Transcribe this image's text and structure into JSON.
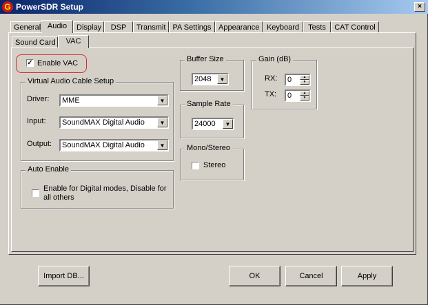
{
  "window": {
    "title": "PowerSDR Setup",
    "close_label": "×",
    "app_icon_letter": "G"
  },
  "tabs": [
    "General",
    "Audio",
    "Display",
    "DSP",
    "Transmit",
    "PA Settings",
    "Appearance",
    "Keyboard",
    "Tests",
    "CAT Control"
  ],
  "active_tab": "Audio",
  "subtabs": [
    "Sound Card",
    "VAC"
  ],
  "active_subtab": "VAC",
  "vac": {
    "enable_label": "Enable VAC",
    "enable_checked": true,
    "check_mark": "✓",
    "setup_title": "Virtual Audio Cable Setup",
    "driver_label": "Driver:",
    "driver_value": "MME",
    "input_label": "Input:",
    "input_value": "SoundMAX Digital Audio",
    "output_label": "Output:",
    "output_value": "SoundMAX Digital Audio",
    "auto_enable_title": "Auto Enable",
    "auto_enable_label": "Enable for Digital modes, Disable for all others",
    "auto_enable_checked": false
  },
  "buffer": {
    "title": "Buffer Size",
    "value": "2048"
  },
  "sample_rate": {
    "title": "Sample Rate",
    "value": "24000"
  },
  "mono_stereo": {
    "title": "Mono/Stereo",
    "stereo_label": "Stereo",
    "stereo_checked": false
  },
  "gain": {
    "title": "Gain (dB)",
    "rx_label": "RX:",
    "rx_value": "0",
    "tx_label": "TX:",
    "tx_value": "0"
  },
  "buttons": {
    "import": "Import DB...",
    "ok": "OK",
    "cancel": "Cancel",
    "apply": "Apply"
  },
  "glyphs": {
    "dropdown": "▼",
    "spin_up": "▲",
    "spin_down": "▼"
  },
  "colors": {
    "titlebar_start": "#0a246a",
    "titlebar_end": "#a6caf0",
    "face": "#d4d0c8",
    "highlight": "#d03030"
  }
}
